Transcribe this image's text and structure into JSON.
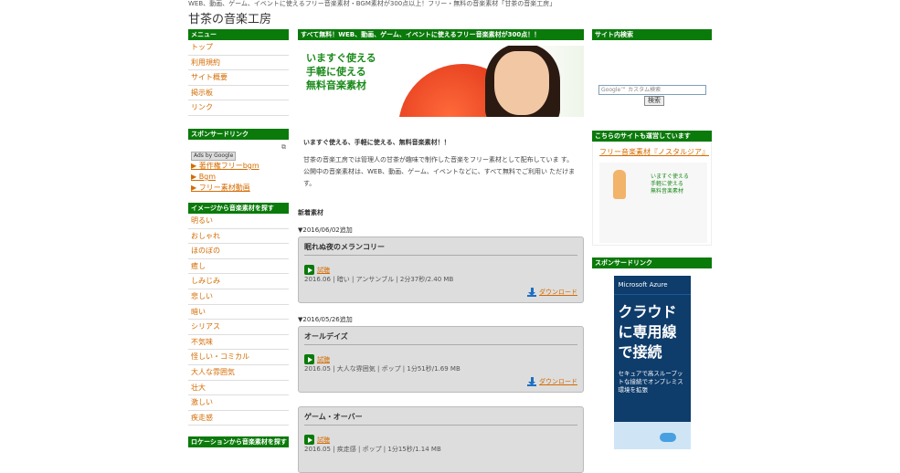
{
  "header": {
    "tagline": "WEB、動画、ゲーム、イベントに使えるフリー音楽素材・BGM素材が300点以上！フリー・無料の音楽素材「甘茶の音楽工房」",
    "title": "甘茶の音楽工房"
  },
  "left": {
    "menu_head": "メニュー",
    "menu": [
      "トップ",
      "利用規約",
      "サイト概要",
      "掲示板",
      "リンク"
    ],
    "sponsor_head": "スポンサードリンク",
    "ads_by": "Ads by Google",
    "ad_links": [
      "▶ 著作権フリーbgm",
      "▶ Bgm",
      "▶ フリー素材動画"
    ],
    "image_head": "イメージから音楽素材を探す",
    "image_items": [
      "明るい",
      "おしゃれ",
      "ほのぼの",
      "癒し",
      "しみじみ",
      "悲しい",
      "暗い",
      "シリアス",
      "不気味",
      "怪しい・コミカル",
      "大人な雰囲気",
      "壮大",
      "激しい",
      "疾走感"
    ],
    "bottom_head": "ロケーションから音楽素材を探す"
  },
  "mid": {
    "head": "すべて無料！WEB、動画、ゲーム、イベントに使えるフリー音楽素材が300点！！",
    "hero_lines": [
      "いますぐ使える",
      "手軽に使える",
      "無料音楽素材"
    ],
    "intro_title": "いますぐ使える、手軽に使える、無料音楽素材！！",
    "intro_body": "甘茶の音楽工房では管理人の甘茶が趣味で制作した音楽をフリー素材として配布していま す。 公開中の音楽素材は、WEB、動画、ゲーム、イベントなどに、すべて無料でご利用い ただけます。",
    "section_title": "新着素材",
    "play_label": "試聴",
    "download_label": "ダウンロード",
    "entries": [
      {
        "date": "▼2016/06/02追加",
        "title": "眠れぬ夜のメランコリー",
        "meta": "2016.06 | 暗い | アンサンブル | 2分37秒/2.40 MB"
      },
      {
        "date": "▼2016/05/26追加",
        "title": "オールデイズ",
        "meta": "2016.05 | 大人な雰囲気 | ポップ | 1分51秒/1.69 MB"
      },
      {
        "date": "",
        "title": "ゲーム・オーバー",
        "meta": "2016.05 | 疾走感 | ポップ | 1分15秒/1.14 MB"
      }
    ]
  },
  "right": {
    "search_head": "サイト内検索",
    "search_placeholder": "Google™ カスタム検索",
    "search_button": "検索",
    "rec_head": "こちらのサイトも運営しています",
    "rec_link": "フリー音楽素材『ノスタルジア』",
    "rec_lines": [
      "いますぐ使える",
      "手軽に使える",
      "無料音楽素材"
    ],
    "sponsor_head": "スポンサードリンク",
    "azure_brand": "Microsoft Azure",
    "azure_main": "クラウドに専用線で接続",
    "azure_sub": "セキュアで高スループットな接続でオンプレミス環境を拡張"
  }
}
